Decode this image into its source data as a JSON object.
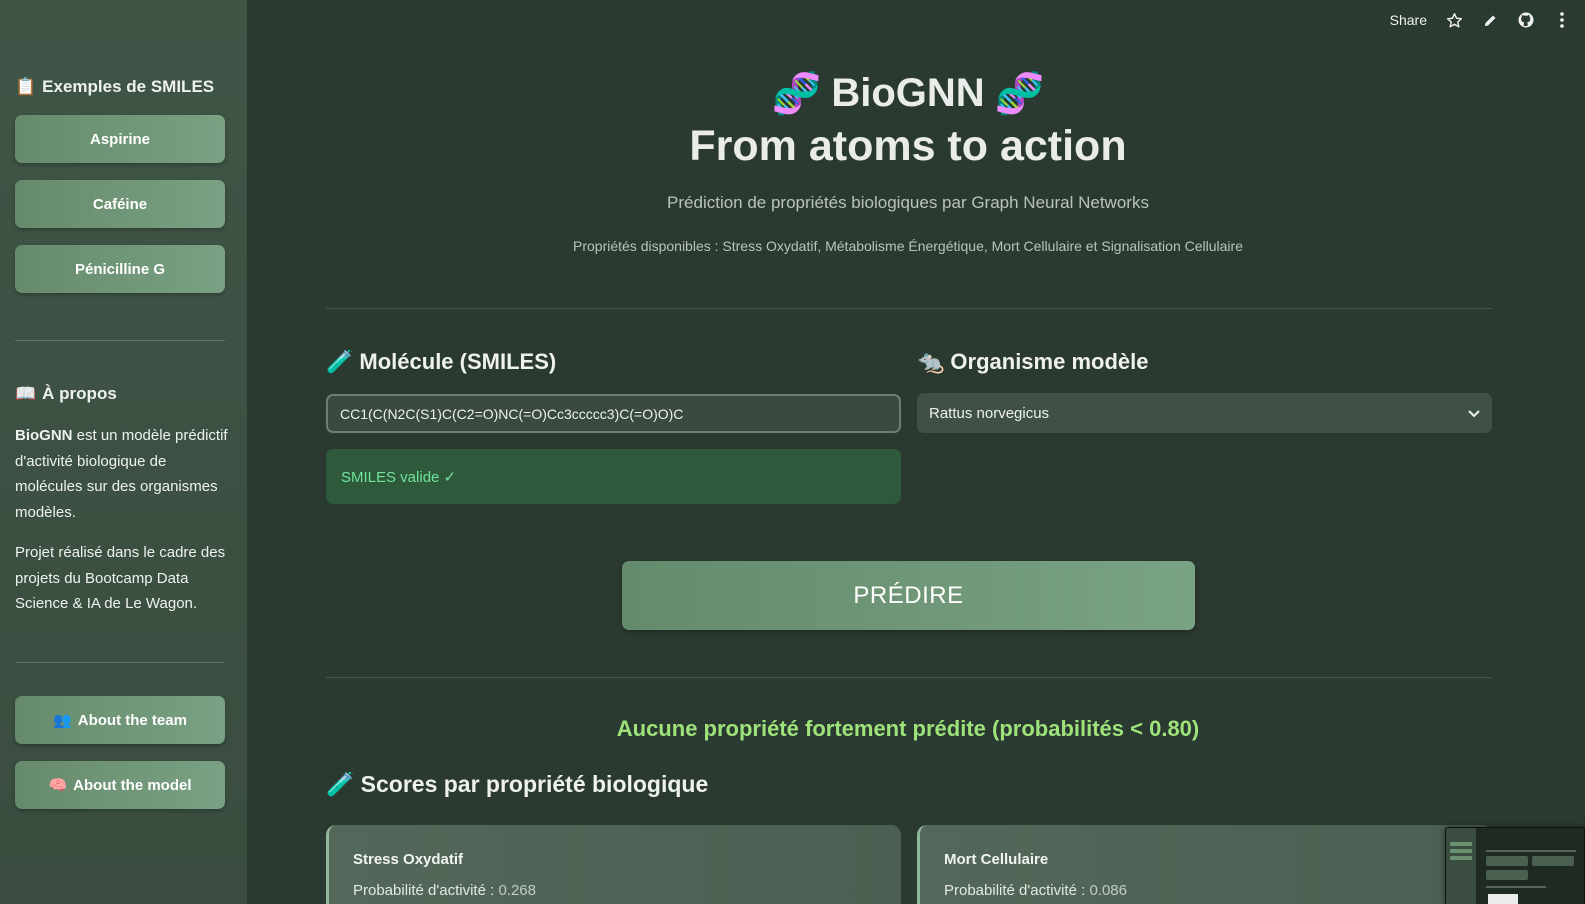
{
  "toolbar": {
    "share_label": "Share"
  },
  "sidebar": {
    "examples_heading": "Exemples de SMILES",
    "examples": [
      {
        "label": "Aspirine"
      },
      {
        "label": "Caféine"
      },
      {
        "label": "Pénicilline G"
      }
    ],
    "about_heading": "À propos",
    "about_bold": "BioGNN",
    "about_text": " est un modèle prédictif d'activité biologique de molécules sur des organismes modèles.",
    "project_text": "Projet réalisé dans le cadre des projets du Bootcamp Data Science & IA de Le Wagon.",
    "team_button": "About the team",
    "model_button": "About the model"
  },
  "header": {
    "title": "BioGNN",
    "tagline": "From atoms to action",
    "subtitle": "Prédiction de propriétés biologiques par Graph Neural Networks",
    "properties": "Propriétés disponibles : Stress Oxydatif, Métabolisme Énergétique, Mort Cellulaire et Signalisation Cellulaire"
  },
  "form": {
    "molecule_label": "Molécule (SMILES)",
    "smiles_value": "CC1(C(N2C(S1)C(C2=O)NC(=O)Cc3ccccc3)C(=O)O)C",
    "organism_label": "Organisme modèle",
    "organism_value": "Rattus norvegicus",
    "validation_text": "SMILES valide ✓",
    "predict_button": "PRÉDIRE"
  },
  "results": {
    "message": "Aucune propriété fortement prédite (probabilités < 0.80)",
    "scores_title": "Scores par propriété biologique",
    "cards": [
      {
        "title": "Stress Oxydatif",
        "prob_label": "Probabilité d'activité : ",
        "prob_value": "0.268"
      },
      {
        "title": "Mort Cellulaire",
        "prob_label": "Probabilité d'activité : ",
        "prob_value": "0.086"
      }
    ]
  },
  "colors": {
    "background": "#2b3a30",
    "sidebar": "#3f5546",
    "button": "#6f9677",
    "success_text": "#6fe39a",
    "result_text": "#9ee27a"
  },
  "icons": [
    "clipboard-icon",
    "book-icon",
    "people-icon",
    "brain-icon",
    "dna-icon",
    "test-tube-icon",
    "rat-icon",
    "star-icon",
    "pencil-icon",
    "github-icon",
    "more-vertical-icon",
    "chevron-down-icon"
  ]
}
